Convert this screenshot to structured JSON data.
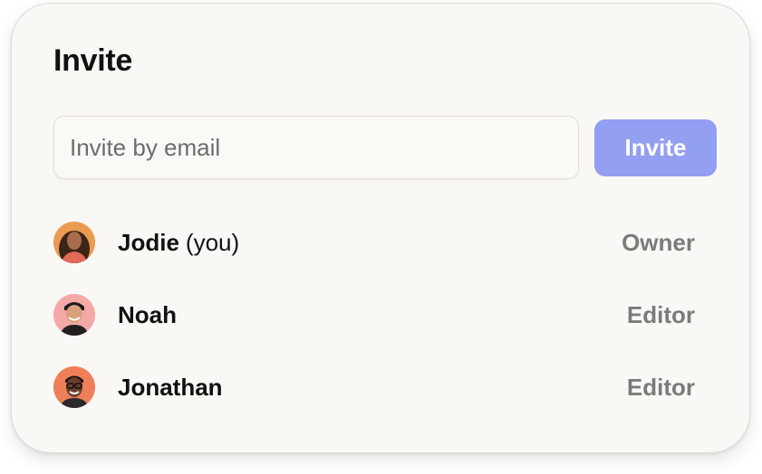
{
  "invite_card": {
    "title": "Invite",
    "email_input": {
      "placeholder": "Invite by email",
      "value": ""
    },
    "invite_button_label": "Invite",
    "colors": {
      "accent": "#939ff0",
      "card_bg": "#faf8f5",
      "role_text": "#7b7b7b"
    }
  },
  "members": [
    {
      "name": "Jodie",
      "suffix": "(you)",
      "role": "Owner",
      "avatar": "avatar-jodie"
    },
    {
      "name": "Noah",
      "suffix": "",
      "role": "Editor",
      "avatar": "avatar-noah"
    },
    {
      "name": "Jonathan",
      "suffix": "",
      "role": "Editor",
      "avatar": "avatar-jonathan"
    }
  ]
}
